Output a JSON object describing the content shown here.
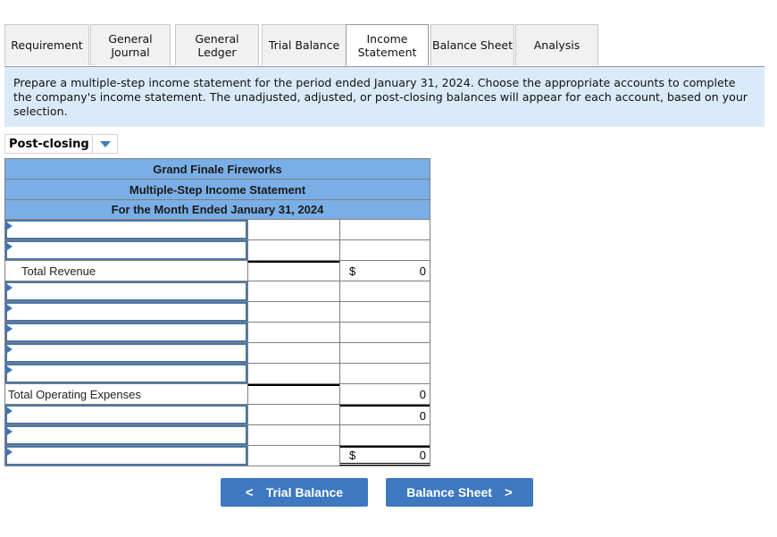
{
  "tabs": [
    {
      "label": "Requirement",
      "active": false
    },
    {
      "label": "General Journal",
      "active": false
    },
    {
      "label": "General Ledger",
      "active": false
    },
    {
      "label": "Trial Balance",
      "active": false
    },
    {
      "label": "Income Statement",
      "active": true
    },
    {
      "label": "Balance Sheet",
      "active": false
    },
    {
      "label": "Analysis",
      "active": false
    }
  ],
  "instructions": "Prepare a multiple-step income statement for the period ended January 31, 2024. Choose the appropriate accounts to complete the company's income statement. The unadjusted, adjusted, or post-closing balances will appear for each account, based on your selection.",
  "balance_selector": {
    "selected": "Post-closing"
  },
  "statement": {
    "company": "Grand Finale Fireworks",
    "title": "Multiple-Step Income Statement",
    "period": "For the Month Ended January 31, 2024",
    "total_revenue_label": "Total Revenue",
    "total_revenue_currency": "$",
    "total_revenue_value": "0",
    "total_operating_expenses_label": "Total Operating Expenses",
    "total_operating_expenses_value": "0",
    "operating_income_value": "0",
    "net_income_currency": "$",
    "net_income_value": "0"
  },
  "nav": {
    "prev_label": "Trial Balance",
    "next_label": "Balance Sheet",
    "prev_chevron": "<",
    "next_chevron": ">"
  }
}
